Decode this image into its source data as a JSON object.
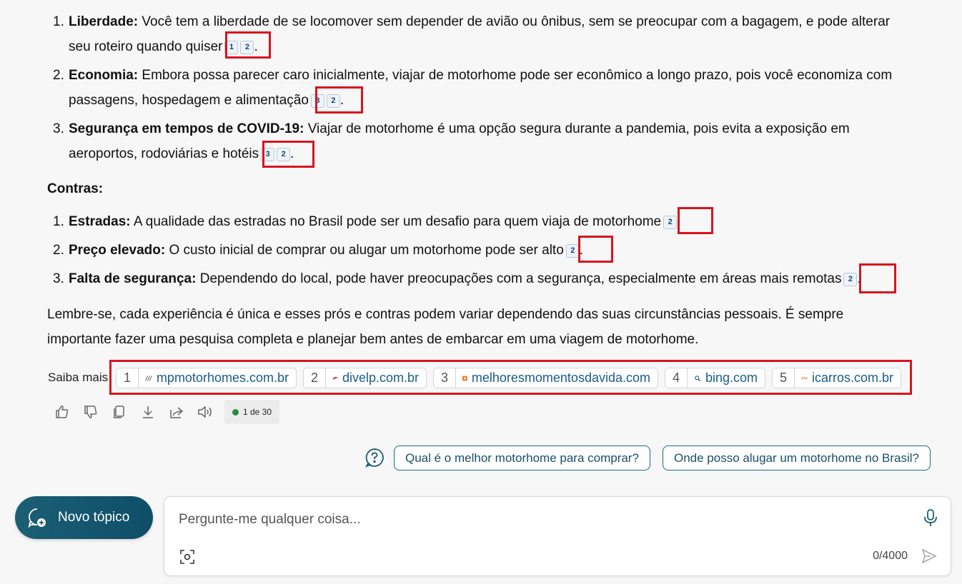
{
  "pros": [
    {
      "num": "1.",
      "title": "Liberdade:",
      "text_line1": "Você tem a liberdade de se locomover sem depender de avião ou ônibus, sem se preocupar com a bagagem, e pode alterar",
      "text_line2": "seu roteiro quando quiser",
      "cites": [
        "1",
        "2"
      ],
      "end": "."
    },
    {
      "num": "2.",
      "title": "Economia:",
      "text_line1": "Embora possa parecer caro inicialmente, viajar de motorhome pode ser econômico a longo prazo, pois você economiza com",
      "text_line2": "passagens, hospedagem e alimentação",
      "cites": [
        "3",
        "2"
      ],
      "end": "."
    },
    {
      "num": "3.",
      "title": "Segurança em tempos de COVID-19:",
      "text_line1": "Viajar de motorhome é uma opção segura durante a pandemia, pois evita a exposição em",
      "text_line2": "aeroportos, rodoviárias e hotéis",
      "cites": [
        "3",
        "2"
      ],
      "end": "."
    }
  ],
  "contras_heading": "Contras:",
  "cons": [
    {
      "num": "1.",
      "title": "Estradas:",
      "text": "A qualidade das estradas no Brasil pode ser um desafio para quem viaja de motorhome",
      "cites": [
        "2"
      ],
      "end": "."
    },
    {
      "num": "2.",
      "title": "Preço elevado:",
      "text": "O custo inicial de comprar ou alugar um motorhome pode ser alto",
      "cites": [
        "2"
      ],
      "end": "."
    },
    {
      "num": "3.",
      "title": "Falta de segurança:",
      "text": "Dependendo do local, pode haver preocupações com a segurança, especialmente em áreas mais remotas",
      "cites": [
        "2"
      ],
      "end": "."
    }
  ],
  "closing_line1": "Lembre-se, cada experiência é única e esses prós e contras podem variar dependendo das suas circunstâncias pessoais. É sempre",
  "closing_line2": "importante fazer uma pesquisa completa e planejar bem antes de embarcar em uma viagem de motorhome.",
  "saiba_mais": "Saiba mais",
  "sources": [
    {
      "idx": "1",
      "domain": "mpmotorhomes.com.br",
      "icon": "mp-logo-icon"
    },
    {
      "idx": "2",
      "domain": "divelp.com.br",
      "icon": "divelp-logo-icon"
    },
    {
      "idx": "3",
      "domain": "melhoresmomentosdavida.com",
      "icon": "orange-square-icon"
    },
    {
      "idx": "4",
      "domain": "bing.com",
      "icon": "bing-search-icon"
    },
    {
      "idx": "5",
      "domain": "icarros.com.br",
      "icon": "icarros-logo-icon"
    }
  ],
  "counter": "1 de 30",
  "suggestions": [
    "Qual é o melhor motorhome para comprar?",
    "Onde posso alugar um motorhome no Brasil?"
  ],
  "new_topic": "Novo tópico",
  "input": {
    "placeholder": "Pergunte-me qualquer coisa...",
    "value": "",
    "char_count": "0/4000"
  },
  "colors": {
    "accent": "#1b5f75",
    "highlight_box": "#d8141e",
    "citation_text": "#114a7a"
  }
}
